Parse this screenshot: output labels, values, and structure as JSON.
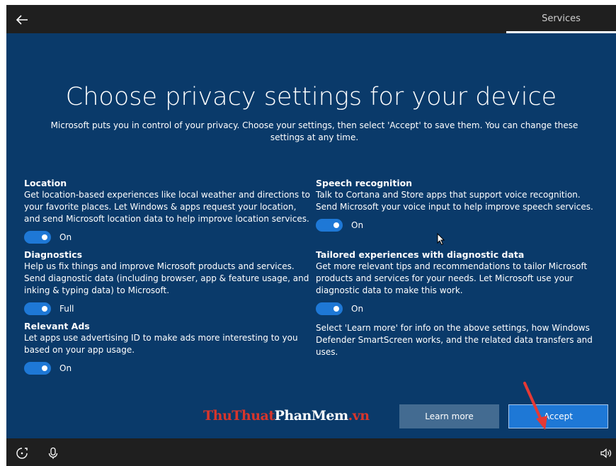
{
  "topbar": {
    "tab_label": "Services"
  },
  "page": {
    "title": "Choose privacy settings for your device",
    "subtitle": "Microsoft puts you in control of your privacy. Choose your settings, then select 'Accept' to save them. You can change these settings at any time."
  },
  "settings": {
    "location": {
      "title": "Location",
      "description": "Get location-based experiences like local weather and directions to your favorite places. Let Windows & apps request your location, and send Microsoft location data to help improve location services.",
      "state": "On"
    },
    "diagnostics": {
      "title": "Diagnostics",
      "description": "Help us fix things and improve Microsoft products and services. Send diagnostic data (including browser, app & feature usage, and inking & typing data) to Microsoft.",
      "state": "Full"
    },
    "relevant_ads": {
      "title": "Relevant Ads",
      "description": "Let apps use advertising ID to make ads more interesting to you based on your app usage.",
      "state": "On"
    },
    "speech": {
      "title": "Speech recognition",
      "description": "Talk to Cortana and Store apps that support voice recognition. Send Microsoft your voice input to help improve speech services.",
      "state": "On"
    },
    "tailored": {
      "title": "Tailored experiences with diagnostic data",
      "description": "Get more relevant tips and recommendations to tailor Microsoft products and services for your needs. Let Microsoft use your diagnostic data to make this work.",
      "state": "On"
    }
  },
  "note": "Select 'Learn more' for info on the above settings, how Windows Defender SmartScreen works, and the related data transfers and uses.",
  "buttons": {
    "learn_more": "Learn more",
    "accept": "Accept"
  },
  "watermark": {
    "part1": "ThuThuat",
    "part2": "PhanMem",
    "part3": ".vn"
  },
  "icons": {
    "back": "back-arrow-icon",
    "ease_of_access": "ease-of-access-icon",
    "microphone": "microphone-icon",
    "volume": "volume-icon"
  },
  "colors": {
    "background": "#0a3a6a",
    "accent": "#1e78d6",
    "secondary_button": "#436b91",
    "bar": "#1f1f1f"
  }
}
